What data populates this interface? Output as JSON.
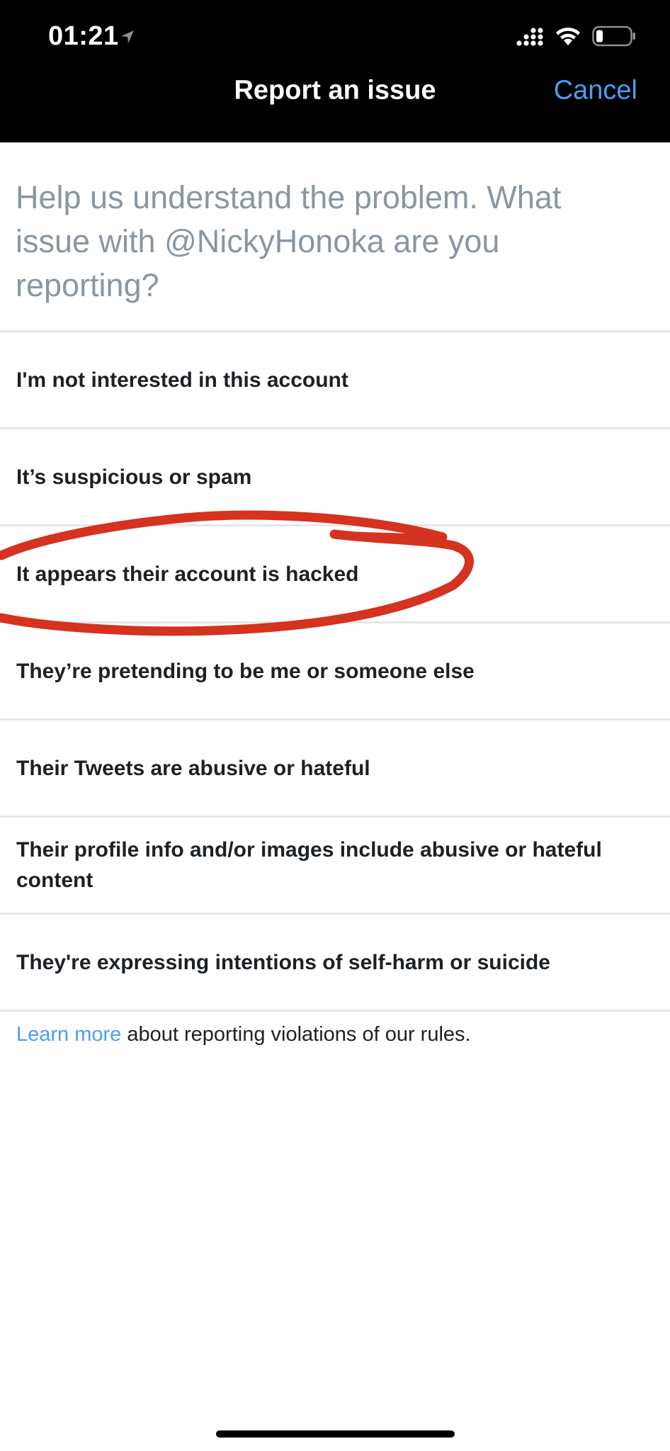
{
  "status_bar": {
    "time": "01:21",
    "icons": [
      "location-arrow-icon",
      "signal-icon",
      "wifi-icon",
      "battery-icon"
    ]
  },
  "nav": {
    "title": "Report an issue",
    "cancel_label": "Cancel"
  },
  "prompt": "Help us understand the problem. What issue with @NickyHonoka are you reporting?",
  "options": [
    {
      "label": "I'm not interested in this account"
    },
    {
      "label": "It’s suspicious or spam"
    },
    {
      "label": "It appears their account is hacked",
      "annotated": true
    },
    {
      "label": "They’re pretending to be me or someone else"
    },
    {
      "label": "Their Tweets are abusive or hateful"
    },
    {
      "label": "Their profile info and/or images include abusive or hateful content"
    },
    {
      "label": "They're expressing intentions of self-harm or suicide"
    }
  ],
  "footer": {
    "link_label": "Learn more",
    "text": " about reporting violations of our rules."
  },
  "colors": {
    "accent": "#4a9ff0",
    "annotation": "#d5321f",
    "prompt_text": "#8a96a1",
    "divider": "#e4e8eb"
  }
}
